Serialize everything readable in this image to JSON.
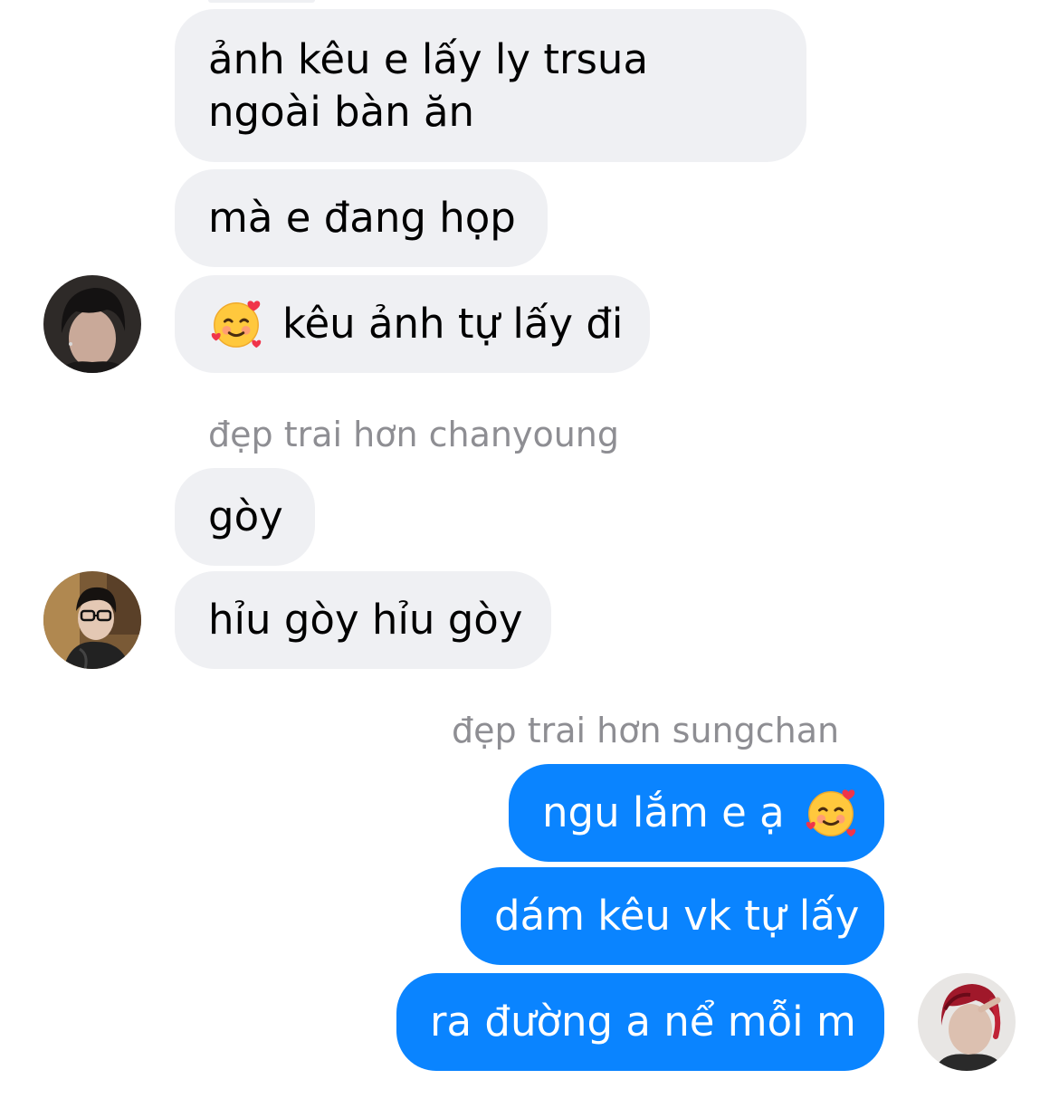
{
  "messages": [
    {
      "id": "m1",
      "text": "ảnh kêu e lấy ly trsua ngoài bàn ăn"
    },
    {
      "id": "m2",
      "text": "mà e đang họp"
    },
    {
      "id": "m3",
      "emoji": "smiling-face-with-hearts-icon",
      "text": "kêu ảnh tự lấy đi"
    },
    {
      "id": "m4",
      "text": "gòy"
    },
    {
      "id": "m5",
      "text": "hỉu gòy hỉu gòy"
    },
    {
      "id": "m6",
      "text": "ngu lắm e ạ",
      "emoji": "smiling-face-with-hearts-icon"
    },
    {
      "id": "m7",
      "text": "dám kêu vk tự lấy"
    },
    {
      "id": "m8",
      "text": "ra đường a nể mỗi m"
    }
  ],
  "senders": {
    "chanyoung_group": "đẹp trai hơn chanyoung",
    "sungchan_group": "đẹp trai hơn sungchan"
  },
  "colors": {
    "incoming_bubble": "#eff0f3",
    "outgoing_bubble": "#0a84ff",
    "sender_label": "#8e8e93"
  }
}
